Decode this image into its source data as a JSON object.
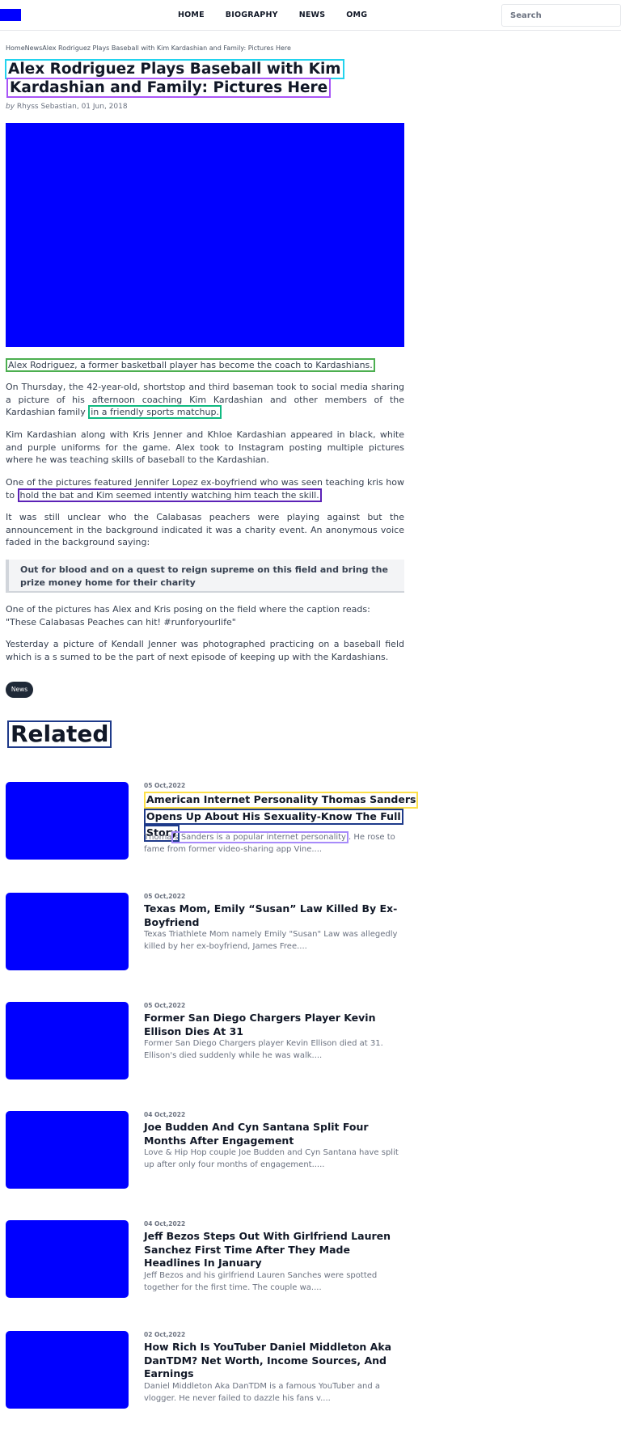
{
  "header": {
    "nav": [
      "HOME",
      "BIOGRAPHY",
      "NEWS",
      "OMG"
    ],
    "search_placeholder": "Search"
  },
  "breadcrumb": {
    "home": "Home",
    "section": "News",
    "current": "Alex Rodriguez Plays Baseball with Kim Kardashian and Family: Pictures Here"
  },
  "article": {
    "title_line1": "Alex Rodriguez Plays Baseball with Kim",
    "title_line2": "Kardashian and Family: Pictures Here",
    "by": "by",
    "author_date": "Rhyss Sebastian, 01 Jun, 2018",
    "p1": "Alex Rodriguez, a former basketball player has become the coach to Kardashians.",
    "p2_main": "On Thursday, the 42-year-old, shortstop and third baseman took to social media sharing a picture of his afternoon coaching Kim Kardashian and other members of the Kardashian family",
    "p2_tail": "in a friendly sports matchup.",
    "p3": "Kim Kardashian along with Kris Jenner and Khloe Kardashian appeared in black, white and purple uniforms for the game. Alex took to Instagram posting multiple pictures where he was teaching skills of baseball to the Kardashian.",
    "p4_main": "One of the pictures featured Jennifer Lopez ex-boyfriend who was seen teaching kris how to",
    "p4_tail": "hold the bat and Kim seemed intently watching him teach the skill.",
    "p5": "It was still unclear who the Calabasas peachers were playing against but the announcement in the background indicated it was a charity event. An anonymous voice faded in the background saying:",
    "quote": "Out for blood and on a quest to reign supreme on this field and bring the prize money home for their charity",
    "p6_line1": "One of the pictures has Alex and Kris posing on the field where the caption reads:",
    "p6_line2": "\"These Calabasas Peaches can hit! #runforyourlife\"",
    "p7": "Yesterday a picture of Kendall Jenner was photographed practicing on a baseball field which is a s sumed to be the part of next episode of keeping up with the Kardashians.",
    "tag": "News"
  },
  "related": {
    "heading": "Related",
    "items": [
      {
        "date": "05 Oct,2022",
        "title_l1": "American Internet Personality Thomas Sanders",
        "title_l2": "Opens Up About His Sexuality-Know The Full",
        "title_l3": "Story",
        "excerpt_a": "Thoma",
        "excerpt_hl": "s Sanders is a popular internet personality",
        "excerpt_b": ". He rose to fame from former video-sharing app Vine...."
      },
      {
        "date": "05 Oct,2022",
        "title": "Texas Mom, Emily “Susan” Law Killed By Ex-Boyfriend",
        "excerpt": "Texas Triathlete Mom namely Emily \"Susan\" Law was allegedly killed by her ex-boyfriend, James Free...."
      },
      {
        "date": "05 Oct,2022",
        "title": "Former San Diego Chargers Player Kevin Ellison Dies At 31",
        "excerpt": "Former San Diego Chargers player Kevin Ellison died at 31. Ellison's died suddenly while he was walk...."
      },
      {
        "date": "04 Oct,2022",
        "title": "Joe Budden And Cyn Santana Split Four Months After Engagement",
        "excerpt": "Love & Hip Hop couple Joe Budden and Cyn Santana have split up after only four months of engagement....."
      },
      {
        "date": "04 Oct,2022",
        "title": "Jeff Bezos Steps Out With Girlfriend Lauren Sanchez First Time After They Made Headlines In January",
        "excerpt": "Jeff Bezos and his girlfriend Lauren Sanches were spotted together for the first time. The couple wa...."
      },
      {
        "date": "02 Oct,2022",
        "title": "How Rich Is YouTuber Daniel Middleton Aka DanTDM? Net Worth, Income Sources, And Earnings",
        "excerpt": "Daniel Middleton Aka DanTDM is a famous YouTuber and a vlogger. He never failed to dazzle his fans v...."
      }
    ]
  }
}
